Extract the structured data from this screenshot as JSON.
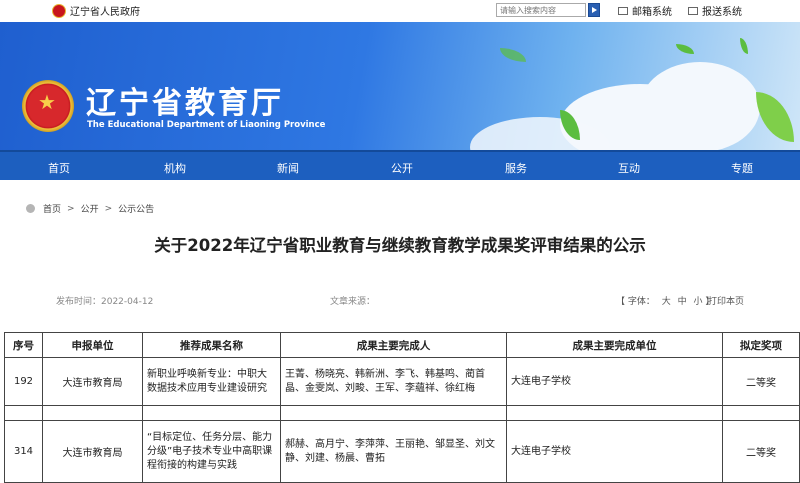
{
  "topbar": {
    "gov_link": "辽宁省人民政府",
    "search_placeholder": "请输入搜索内容",
    "mail_label": "邮箱系统",
    "report_label": "报送系统"
  },
  "banner": {
    "title": "辽宁省教育厅",
    "subtitle": "The Educational Department of Liaoning Province"
  },
  "nav": [
    "首页",
    "机构",
    "新闻",
    "公开",
    "服务",
    "互动",
    "专题"
  ],
  "breadcrumb": [
    "首页",
    "公开",
    "公示公告"
  ],
  "breadcrumb_sep": ">",
  "article": {
    "title": "关于2022年辽宁省职业教育与继续教育教学成果奖评审结果的公示",
    "date": "发布时间：2022-04-12",
    "source": "文章来源：",
    "font_label": "【 字体：",
    "font_sizes": [
      "大",
      "中",
      "小"
    ],
    "font_close": "】",
    "print_label": "打印本页"
  },
  "table": {
    "headers": [
      "序号",
      "申报单位",
      "推荐成果名称",
      "成果主要完成人",
      "成果主要完成单位",
      "拟定奖项"
    ],
    "rows": [
      {
        "no": "192",
        "unit": "大连市教育局",
        "name": "新职业呼唤新专业：中职大数据技术应用专业建设研究",
        "people": "王菁、杨晓亮、韩新洲、李飞、韩基鸣、蔺首晶、金雯岚、刘畯、王军、李蘊祥、徐红梅",
        "org": "大连电子学校",
        "award": "二等奖"
      },
      {
        "no": "314",
        "unit": "大连市教育局",
        "name": "“目标定位、任务分层、能力分级”电子技术专业中高职课程衔接的构建与实践",
        "people": "郝赫、高月宁、李萍萍、王丽艳、邹显圣、刘文静、刘建、杨晨、曹拓",
        "org": "大连电子学校",
        "award": "二等奖"
      }
    ]
  },
  "colors": {
    "nav_bg": "#1d5fbf",
    "banner_blue": "#2f78e3",
    "emblem_red": "#d7282c"
  }
}
